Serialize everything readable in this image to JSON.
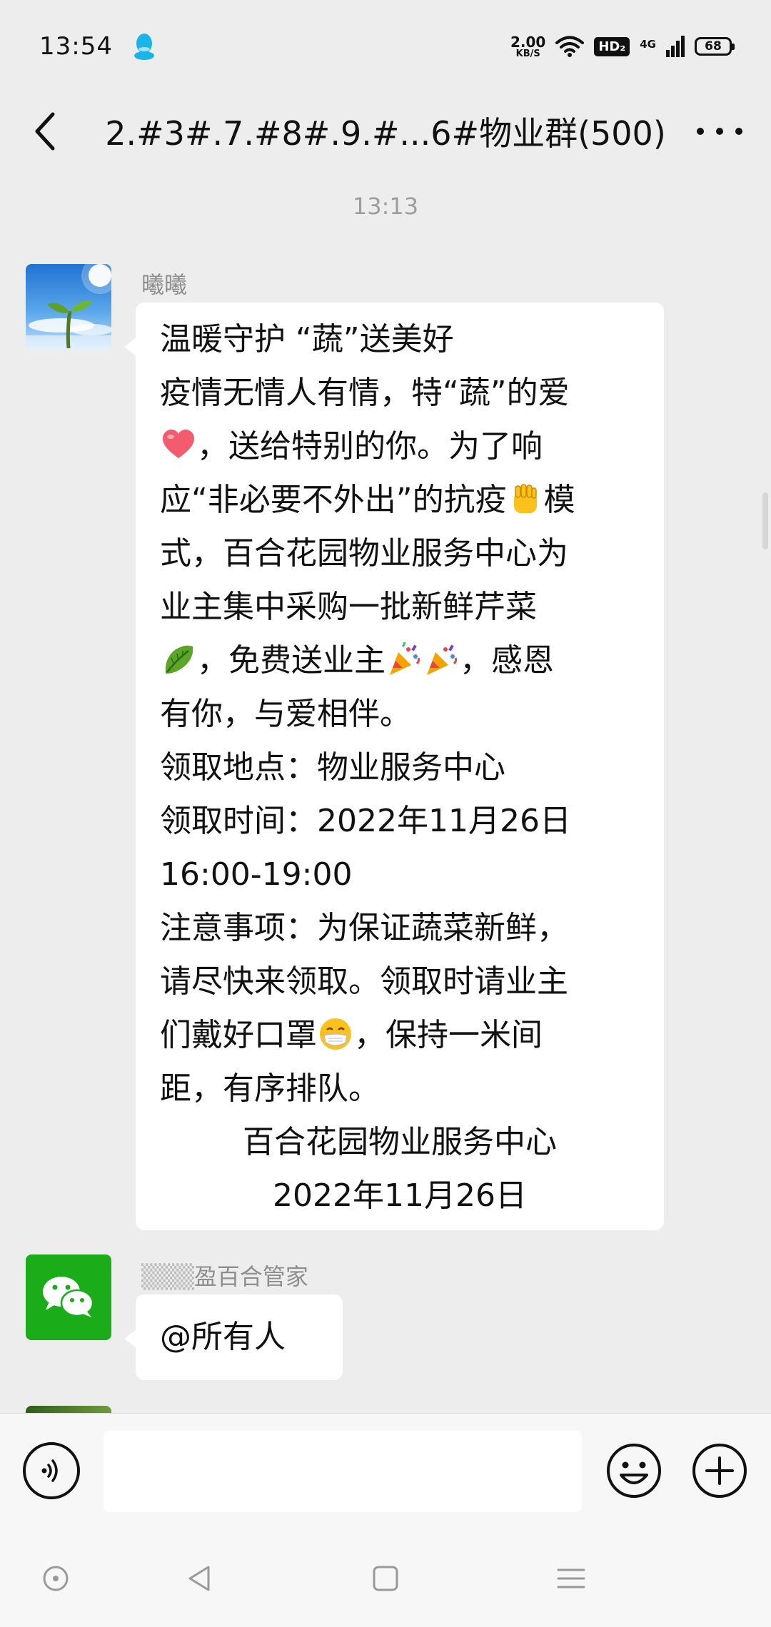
{
  "status_bar": {
    "time": "13:54",
    "net_speed_value": "2.00",
    "net_speed_unit": "KB/S",
    "hd_label": "HD₂",
    "signal_label": "4G",
    "battery": "68"
  },
  "header": {
    "title": "2.#3#.7.#8#.9.#...6#物业群(500)"
  },
  "chat": {
    "timestamp": "13:13",
    "messages": [
      {
        "sender": "曦曦",
        "lines": [
          "温暖守护 “蔬”送美好",
          "疫情无情人有情，特“蔬”的爱",
          "，送给特别的你。为了响",
          "应“非必要不外出”的抗疫",
          "模",
          "式，百合花园物业服务中心为",
          "业主集中采购一批新鲜芹菜",
          "，免费送业主",
          "，感恩",
          "有你，与爱相伴。",
          "领取地点：物业服务中心",
          "领取时间：2022年11月26日",
          "16:00-19:00",
          "注意事项：为保证蔬菜新鲜，",
          "请尽快来领取。领取时请业主",
          "们戴好口罩",
          "，保持一米间",
          "距，有序排队。",
          "百合花园物业服务中心",
          "2022年11月26日"
        ]
      },
      {
        "sender_prefix": "▒▒▒",
        "sender": "盈百合管家",
        "text": "@所有人"
      }
    ]
  },
  "icons": {
    "back": "chevron-left-icon",
    "more": "more-dots-icon",
    "voice": "voice-icon",
    "emoji": "emoji-icon",
    "plus": "plus-icon"
  },
  "colors": {
    "background": "#ededed",
    "bubble": "#ffffff",
    "wechat_green": "#1aad19",
    "meta_text": "#9d9d9d"
  }
}
